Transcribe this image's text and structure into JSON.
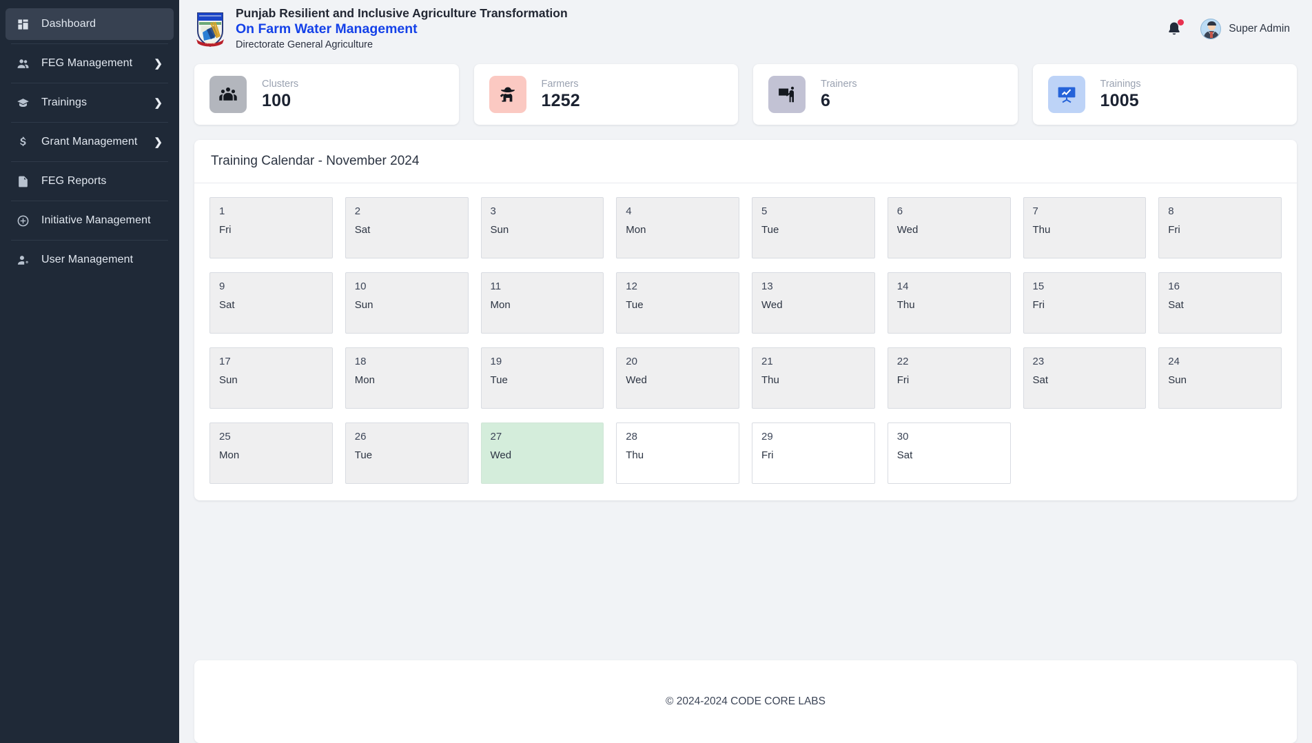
{
  "sidebar": {
    "items": [
      {
        "label": "Dashboard",
        "icon": "dashboard-grid-icon",
        "active": true,
        "expandable": false
      },
      {
        "label": "FEG Management",
        "icon": "users-icon",
        "active": false,
        "expandable": true
      },
      {
        "label": "Trainings",
        "icon": "graduation-cap-icon",
        "active": false,
        "expandable": true
      },
      {
        "label": "Grant Management",
        "icon": "dollar-icon",
        "active": false,
        "expandable": true
      },
      {
        "label": "FEG Reports",
        "icon": "report-document-icon",
        "active": false,
        "expandable": false
      },
      {
        "label": "Initiative Management",
        "icon": "plus-circle-icon",
        "active": false,
        "expandable": false
      },
      {
        "label": "User Management",
        "icon": "user-gear-icon",
        "active": false,
        "expandable": false
      }
    ]
  },
  "header": {
    "logo_icon": "punjab-government-crest-icon",
    "line1": "Punjab Resilient and Inclusive Agriculture Transformation",
    "line2": "On Farm Water Management",
    "line3": "Directorate General Agriculture",
    "line2_color": "#1441e8",
    "notification_icon": "bell-icon",
    "notification_dot_color": "#e8314f",
    "avatar_icon": "user-avatar-icon",
    "username": "Super Admin"
  },
  "stats": [
    {
      "label": "Clusters",
      "value": "100",
      "icon": "group-people-icon",
      "bg": "#b3b6bd"
    },
    {
      "label": "Farmers",
      "value": "1252",
      "icon": "farmer-icon",
      "bg": "#fbc9c2"
    },
    {
      "label": "Trainers",
      "value": "6",
      "icon": "trainer-whiteboard-icon",
      "bg": "#c2c2d4"
    },
    {
      "label": "Trainings",
      "value": "1005",
      "icon": "presentation-chart-icon",
      "bg": "#bdd3f7"
    }
  ],
  "calendar": {
    "title": "Training Calendar - November 2024",
    "today_highlight_color": "#d4eddb",
    "days": [
      {
        "num": "1",
        "dow": "Fri",
        "state": "filled"
      },
      {
        "num": "2",
        "dow": "Sat",
        "state": "filled"
      },
      {
        "num": "3",
        "dow": "Sun",
        "state": "filled"
      },
      {
        "num": "4",
        "dow": "Mon",
        "state": "filled"
      },
      {
        "num": "5",
        "dow": "Tue",
        "state": "filled"
      },
      {
        "num": "6",
        "dow": "Wed",
        "state": "filled"
      },
      {
        "num": "7",
        "dow": "Thu",
        "state": "filled"
      },
      {
        "num": "8",
        "dow": "Fri",
        "state": "filled"
      },
      {
        "num": "9",
        "dow": "Sat",
        "state": "filled"
      },
      {
        "num": "10",
        "dow": "Sun",
        "state": "filled"
      },
      {
        "num": "11",
        "dow": "Mon",
        "state": "filled"
      },
      {
        "num": "12",
        "dow": "Tue",
        "state": "filled"
      },
      {
        "num": "13",
        "dow": "Wed",
        "state": "filled"
      },
      {
        "num": "14",
        "dow": "Thu",
        "state": "filled"
      },
      {
        "num": "15",
        "dow": "Fri",
        "state": "filled"
      },
      {
        "num": "16",
        "dow": "Sat",
        "state": "filled"
      },
      {
        "num": "17",
        "dow": "Sun",
        "state": "filled"
      },
      {
        "num": "18",
        "dow": "Mon",
        "state": "filled"
      },
      {
        "num": "19",
        "dow": "Tue",
        "state": "filled"
      },
      {
        "num": "20",
        "dow": "Wed",
        "state": "filled"
      },
      {
        "num": "21",
        "dow": "Thu",
        "state": "filled"
      },
      {
        "num": "22",
        "dow": "Fri",
        "state": "filled"
      },
      {
        "num": "23",
        "dow": "Sat",
        "state": "filled"
      },
      {
        "num": "24",
        "dow": "Sun",
        "state": "filled"
      },
      {
        "num": "25",
        "dow": "Mon",
        "state": "filled"
      },
      {
        "num": "26",
        "dow": "Tue",
        "state": "filled"
      },
      {
        "num": "27",
        "dow": "Wed",
        "state": "today"
      },
      {
        "num": "28",
        "dow": "Thu",
        "state": "empty"
      },
      {
        "num": "29",
        "dow": "Fri",
        "state": "empty"
      },
      {
        "num": "30",
        "dow": "Sat",
        "state": "empty"
      }
    ]
  },
  "footer": {
    "text": "© 2024-2024 CODE CORE LABS"
  }
}
